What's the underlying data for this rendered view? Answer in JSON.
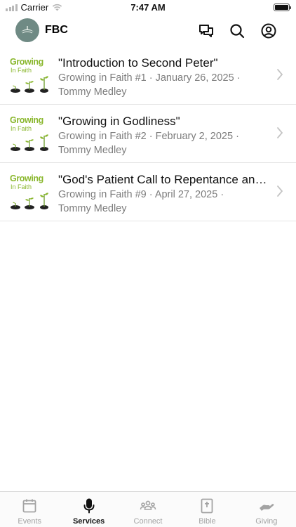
{
  "status_bar": {
    "carrier": "Carrier",
    "time": "7:47 AM"
  },
  "header": {
    "org_name": "FBC",
    "icons": [
      "chat-icon",
      "search-icon",
      "account-icon"
    ]
  },
  "sermons": [
    {
      "thumbnail_title": "Growing",
      "thumbnail_subtitle": "In Faith",
      "title": "\"Introduction to Second Peter\"",
      "meta_line1": "Growing in Faith #1 · January 26, 2025 ·",
      "meta_line2": "Tommy Medley"
    },
    {
      "thumbnail_title": "Growing",
      "thumbnail_subtitle": "In Faith",
      "title": "\"Growing in Godliness\"",
      "meta_line1": "Growing in Faith #2 · February 2, 2025 ·",
      "meta_line2": "Tommy Medley"
    },
    {
      "thumbnail_title": "Growing",
      "thumbnail_subtitle": "In Faith",
      "title": "\"God's Patient Call to Repentance and Readiness\"",
      "meta_line1": "Growing in Faith #9 · April 27, 2025 ·",
      "meta_line2": "Tommy Medley"
    }
  ],
  "tabs": [
    {
      "label": "Events",
      "icon": "calendar-icon",
      "active": false
    },
    {
      "label": "Services",
      "icon": "microphone-icon",
      "active": true
    },
    {
      "label": "Connect",
      "icon": "group-icon",
      "active": false
    },
    {
      "label": "Bible",
      "icon": "bible-icon",
      "active": false
    },
    {
      "label": "Giving",
      "icon": "giving-hand-icon",
      "active": false
    }
  ],
  "colors": {
    "accent_green": "#8ab72d",
    "active_tab": "#111111",
    "inactive_tab": "#a3a3a3",
    "meta_text": "#7c7c7c",
    "logo_bg": "#6f8a84"
  }
}
